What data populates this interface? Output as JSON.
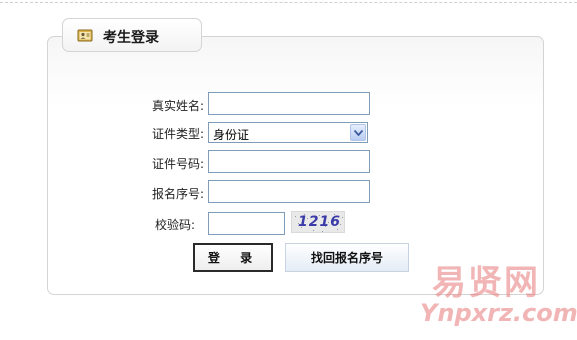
{
  "panel": {
    "title": "考生登录",
    "icon": "id-card-icon"
  },
  "form": {
    "name_label": "真实姓名:",
    "name_value": "",
    "id_type_label": "证件类型:",
    "id_type_selected": "身份证",
    "id_number_label": "证件号码:",
    "id_number_value": "",
    "reg_number_label": "报名序号:",
    "reg_number_value": "",
    "captcha_label": "校验码:",
    "captcha_value": "",
    "captcha_image_text": "1216"
  },
  "buttons": {
    "login_label": "登 录",
    "find_label": "找回报名序号"
  },
  "watermark": {
    "cn": "易贤网",
    "en": "Ynpxrz.com"
  },
  "colors": {
    "input_border": "#7f9db9",
    "captcha_text": "#3a3aa8",
    "watermark": "#e87878"
  }
}
